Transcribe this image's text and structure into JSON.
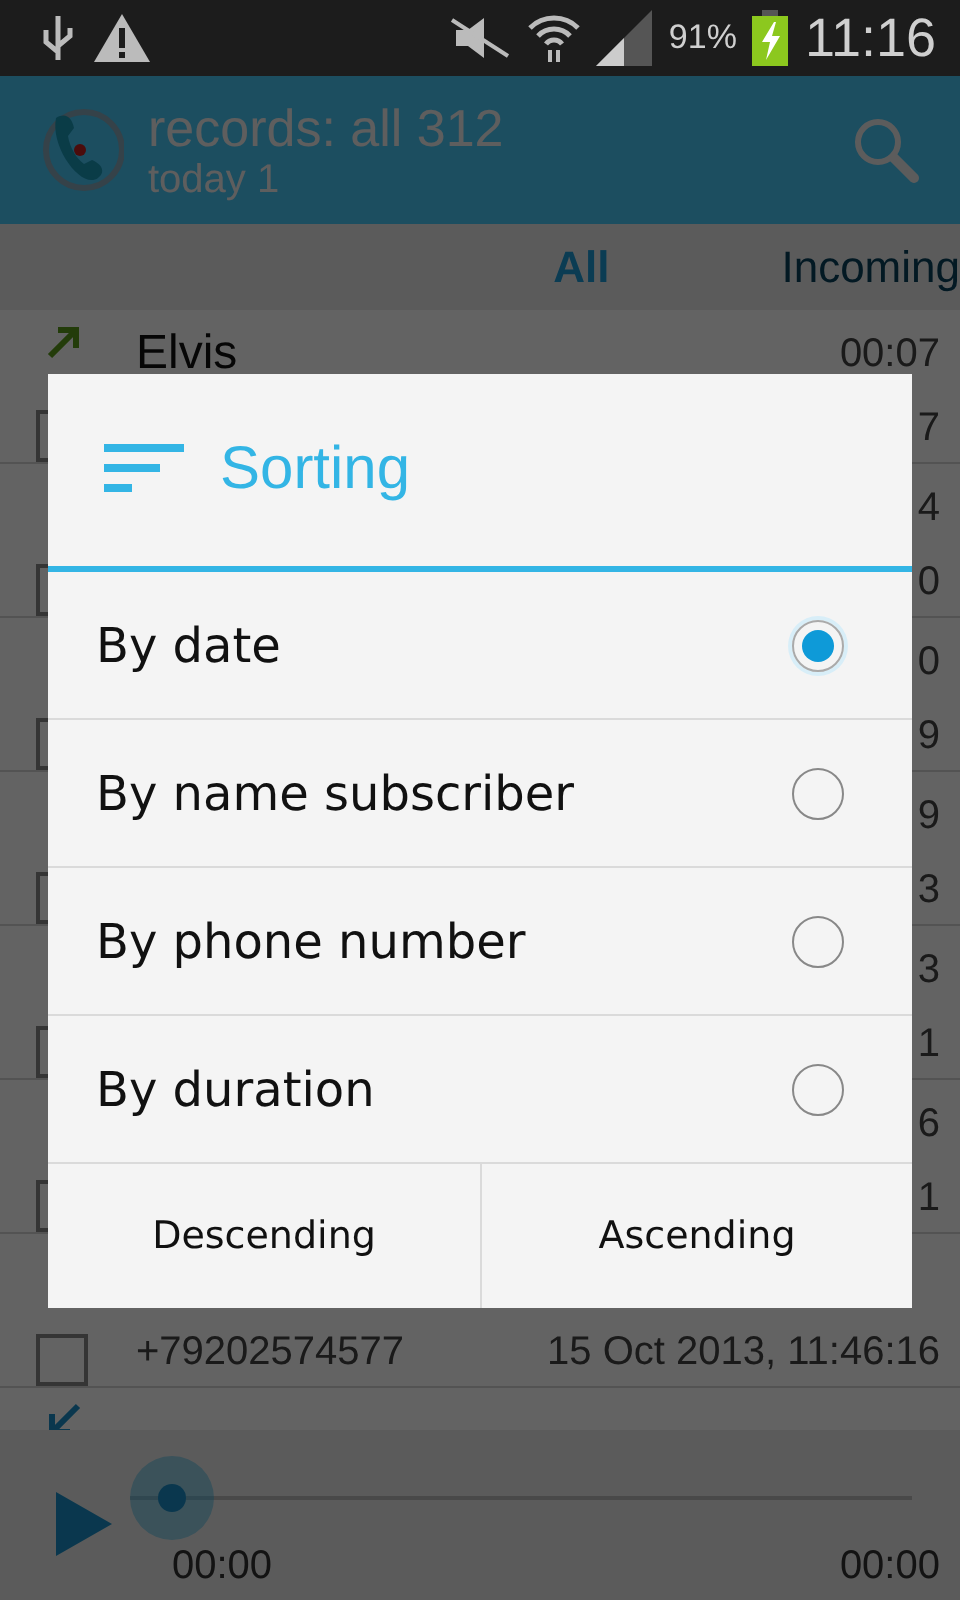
{
  "status_bar": {
    "battery": "91%",
    "time": "11:16"
  },
  "app_bar": {
    "title": "records: all 312",
    "subtitle": "today 1"
  },
  "tabs": [
    {
      "label": "All",
      "selected": true
    },
    {
      "label": "Incoming",
      "selected": false
    }
  ],
  "records": [
    {
      "kind": "outgoing",
      "name": "Elvis",
      "duration": "00:07",
      "date": "7",
      "checked": false
    },
    {
      "duration": "4",
      "date": "0",
      "checked": false
    },
    {
      "duration": "0",
      "date": "9",
      "checked": false
    },
    {
      "duration": "9",
      "date": "3",
      "checked": false
    },
    {
      "duration": "3",
      "date": "1",
      "checked": false
    },
    {
      "duration": "6",
      "date": "1",
      "checked": false
    },
    {
      "phone": "+79202574577",
      "date": "15 Oct 2013, 11:46:16",
      "checked": false
    },
    {
      "kind": "incoming"
    }
  ],
  "player": {
    "level": 0,
    "elapsed": "00:00",
    "total": "00:00"
  },
  "dialog": {
    "title": "Sorting",
    "options": [
      {
        "label": "By date",
        "selected": true
      },
      {
        "label": "By name subscriber",
        "selected": false
      },
      {
        "label": "By phone number",
        "selected": false
      },
      {
        "label": "By duration",
        "selected": false
      }
    ],
    "buttons": [
      "Descending",
      "Ascending"
    ]
  }
}
